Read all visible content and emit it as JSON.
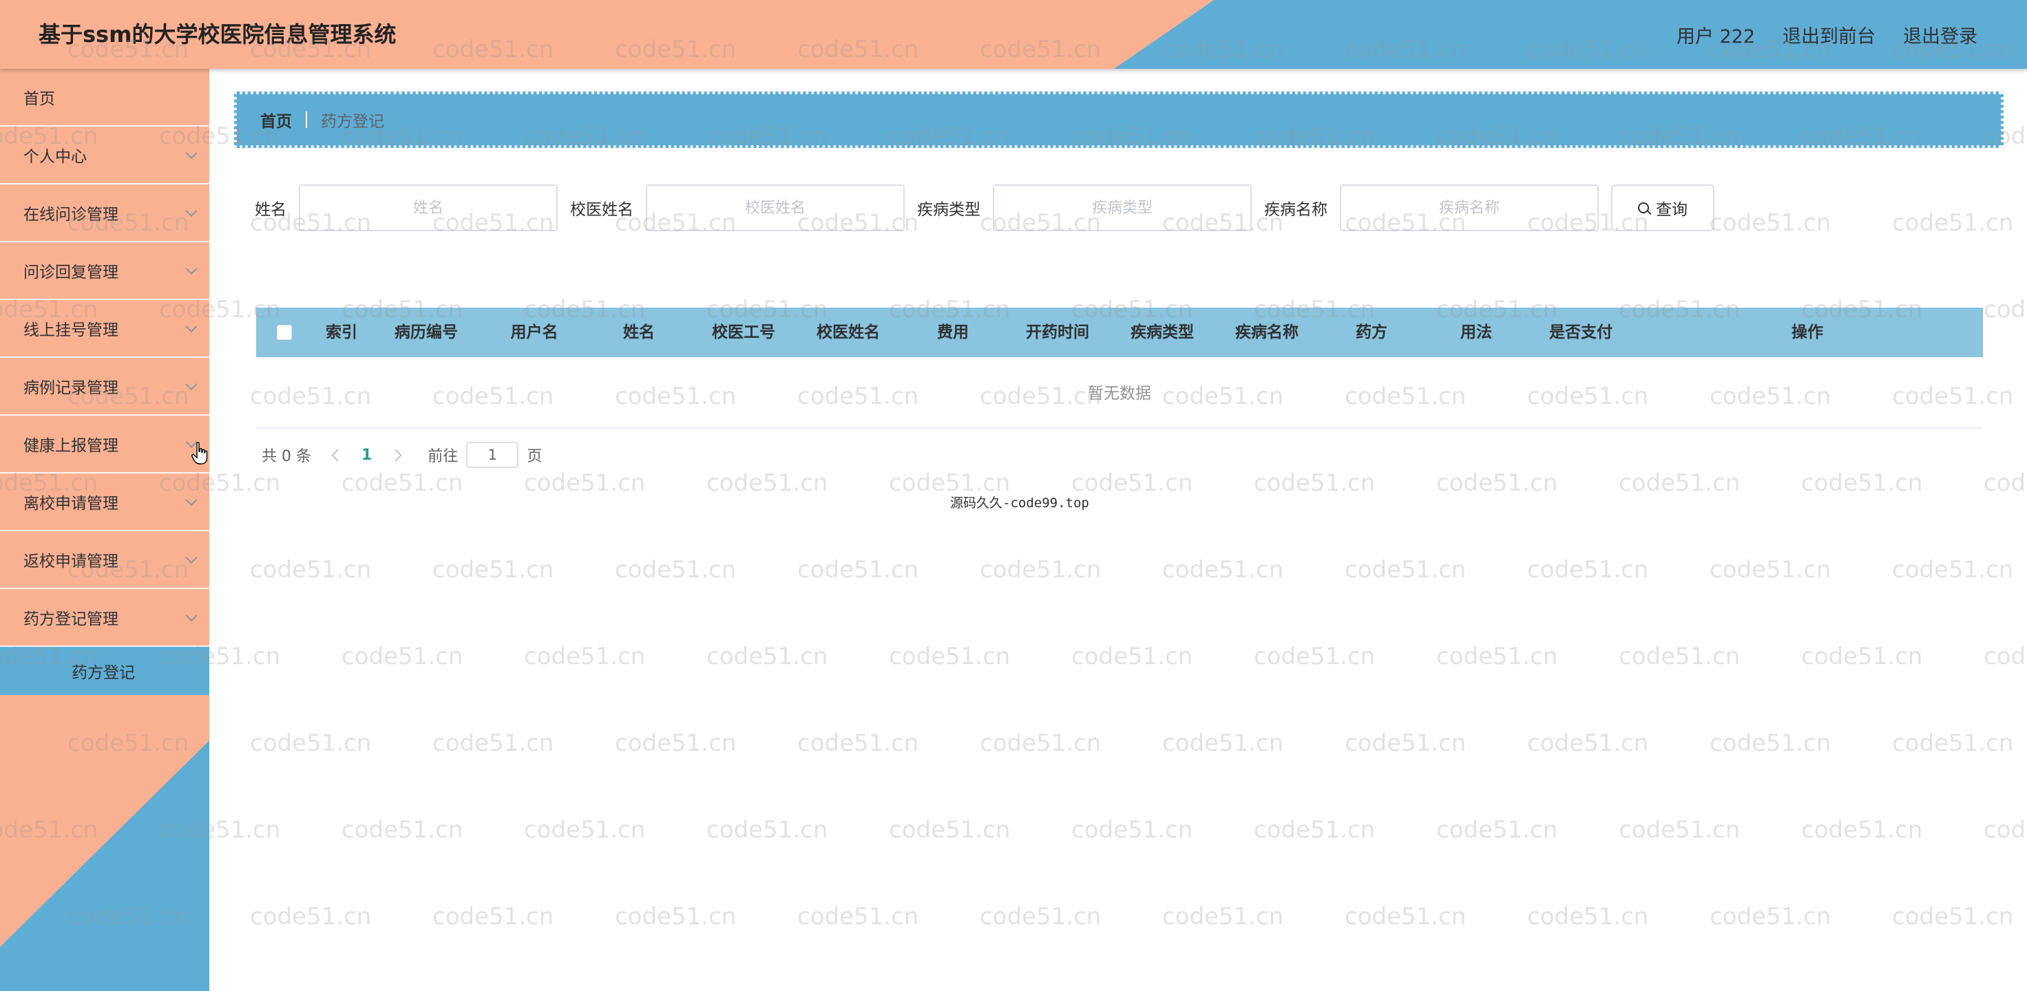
{
  "header": {
    "title": "基于ssm的大学校医院信息管理系统",
    "user": "用户 222",
    "front_link": "退出到前台",
    "logout": "退出登录"
  },
  "sidebar": {
    "items": [
      {
        "label": "首页"
      },
      {
        "label": "个人中心"
      },
      {
        "label": "在线问诊管理"
      },
      {
        "label": "问诊回复管理"
      },
      {
        "label": "线上挂号管理"
      },
      {
        "label": "病例记录管理"
      },
      {
        "label": "健康上报管理"
      },
      {
        "label": "离校申请管理"
      },
      {
        "label": "返校申请管理"
      },
      {
        "label": "药方登记管理"
      }
    ],
    "sub_item": "药方登记"
  },
  "breadcrumb": {
    "home": "首页",
    "current": "药方登记"
  },
  "search": {
    "fields": [
      {
        "label": "姓名",
        "placeholder": "姓名"
      },
      {
        "label": "校医姓名",
        "placeholder": "校医姓名"
      },
      {
        "label": "疾病类型",
        "placeholder": "疾病类型"
      },
      {
        "label": "疾病名称",
        "placeholder": "疾病名称"
      }
    ],
    "button": "查询"
  },
  "table": {
    "columns": [
      "索引",
      "病历编号",
      "用户名",
      "姓名",
      "校医工号",
      "校医姓名",
      "费用",
      "开药时间",
      "疾病类型",
      "疾病名称",
      "药方",
      "用法",
      "是否支付",
      "操作"
    ],
    "empty_text": "暂无数据"
  },
  "pagination": {
    "total": "共 0 条",
    "current_page": "1",
    "goto_label": "前往",
    "goto_value": "1",
    "page_suffix": "页"
  },
  "footer_note": "源码久久-code99.top",
  "watermark": "code51.cn",
  "colors": {
    "salmon": "#fab192",
    "blue": "#5eadd5",
    "table_header": "#8ac4de"
  }
}
